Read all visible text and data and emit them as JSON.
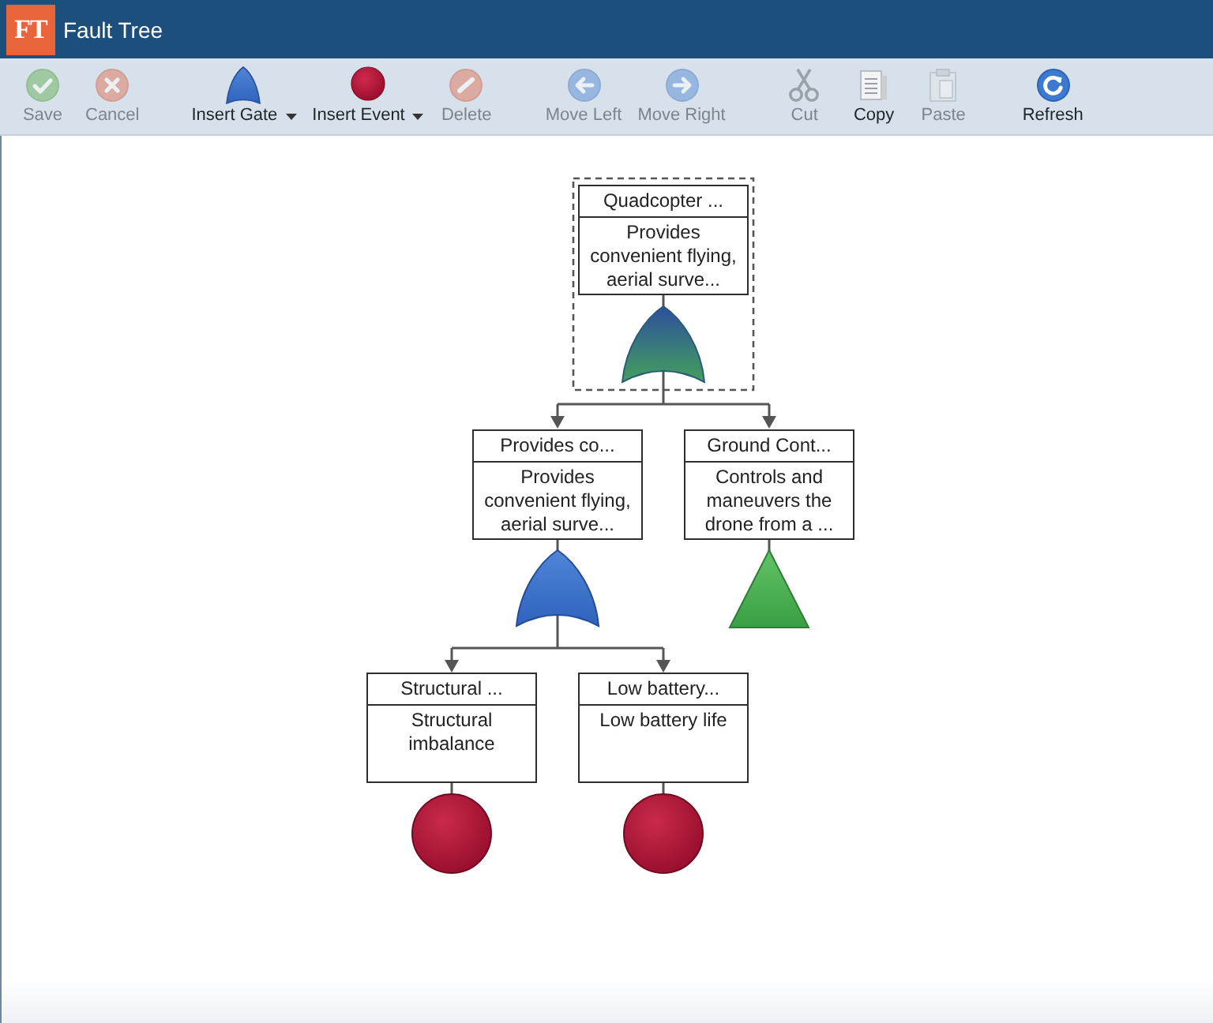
{
  "app_bar": {
    "logo": "FT",
    "title": "Fault Tree"
  },
  "toolbar": {
    "groups": [
      {
        "buttons": [
          {
            "kind": "save",
            "label": "Save",
            "disabled": true,
            "dropdown": false
          },
          {
            "kind": "cancel",
            "label": "Cancel",
            "disabled": true,
            "dropdown": false
          }
        ]
      },
      {
        "buttons": [
          {
            "kind": "insert-gate",
            "label": "Insert Gate",
            "disabled": false,
            "dropdown": true
          },
          {
            "kind": "insert-event",
            "label": "Insert Event",
            "disabled": false,
            "dropdown": true
          },
          {
            "kind": "delete",
            "label": "Delete",
            "disabled": true,
            "dropdown": false
          }
        ]
      },
      {
        "buttons": [
          {
            "kind": "move-left",
            "label": "Move Left",
            "disabled": true,
            "dropdown": false
          },
          {
            "kind": "move-right",
            "label": "Move Right",
            "disabled": true,
            "dropdown": false
          }
        ]
      },
      {
        "buttons": [
          {
            "kind": "cut",
            "label": "Cut",
            "disabled": true,
            "dropdown": false
          },
          {
            "kind": "copy",
            "label": "Copy",
            "disabled": false,
            "dropdown": false
          },
          {
            "kind": "paste",
            "label": "Paste",
            "disabled": true,
            "dropdown": false
          }
        ]
      },
      {
        "buttons": [
          {
            "kind": "refresh",
            "label": "Refresh",
            "disabled": false,
            "dropdown": false
          }
        ]
      }
    ]
  },
  "tree": {
    "title": "Quadcopter ...",
    "description": "Provides convenient flying, aerial surve...",
    "kind": "or",
    "selected": true,
    "children": [
      {
        "title": "Provides co...",
        "description": "Provides convenient flying, aerial surve...",
        "kind": "or",
        "selected": false,
        "children": [
          {
            "title": "Structural ...",
            "description": "Structural imbalance",
            "kind": "basic",
            "selected": false
          },
          {
            "title": "Low battery...",
            "description": "Low battery life",
            "kind": "basic",
            "selected": false
          }
        ]
      },
      {
        "title": "Ground Cont...",
        "description": "Controls and maneuvers the drone from a ...",
        "kind": "transfer",
        "selected": false
      }
    ]
  }
}
